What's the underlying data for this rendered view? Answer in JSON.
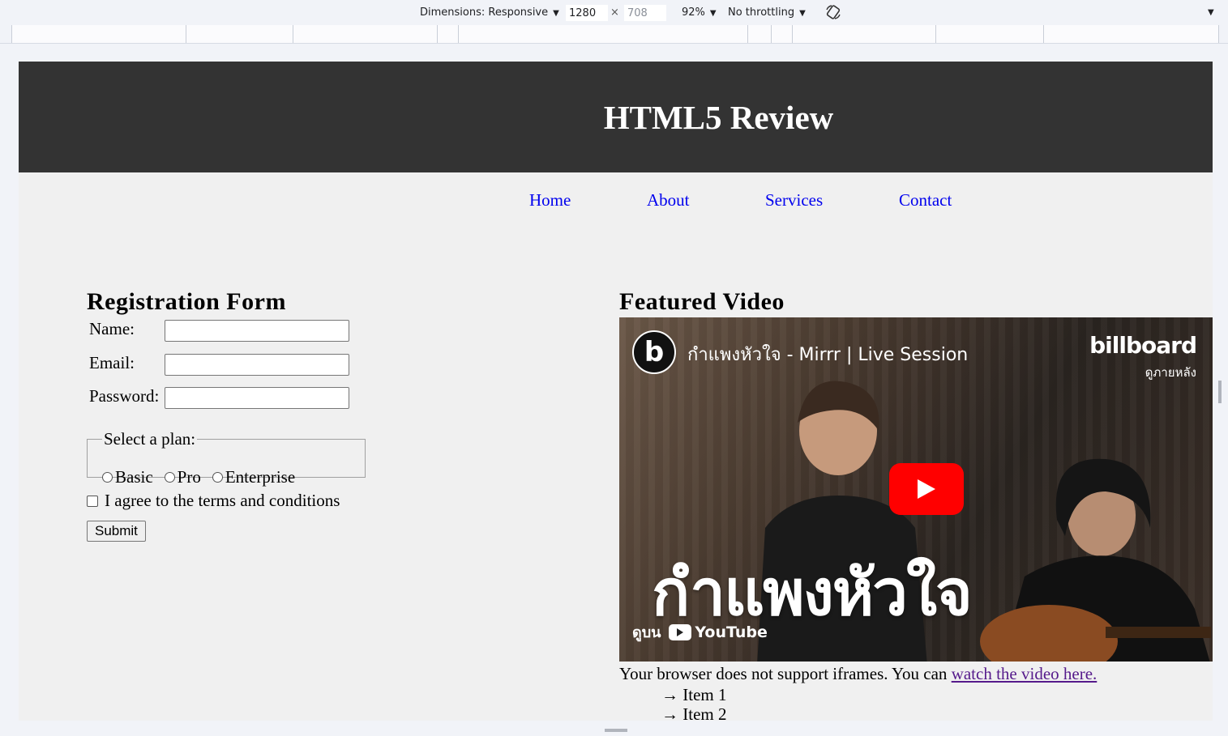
{
  "devtools": {
    "dimensions_label": "Dimensions: Responsive",
    "width_value": "1280",
    "height_value": "708",
    "times": "×",
    "zoom": "92%",
    "throttling": "No throttling"
  },
  "page": {
    "title": "HTML5 Review",
    "nav": [
      "Home",
      "About",
      "Services",
      "Contact"
    ],
    "form": {
      "heading": "Registration Form",
      "name_label": "Name:",
      "email_label": "Email:",
      "password_label": "Password:",
      "plan_legend": "Select a plan:",
      "plans": [
        "Basic",
        "Pro",
        "Enterprise"
      ],
      "agree_label": "I agree to the terms and conditions",
      "submit_label": "Submit"
    },
    "video": {
      "heading": "Featured Video",
      "video_title": "กำแพงหัวใจ - Mirrr | Live Session",
      "brand": "billboard",
      "brand_sub": "ดูภายหลัง",
      "big_text": "กำแพงหัวใจ",
      "watch_on": "ดูบน",
      "youtube": "YouTube",
      "fallback_text": "Your browser does not support iframes. You can ",
      "fallback_link": "watch the video here.",
      "list_items": [
        "→  Item 1",
        "→  Item 2"
      ]
    }
  }
}
